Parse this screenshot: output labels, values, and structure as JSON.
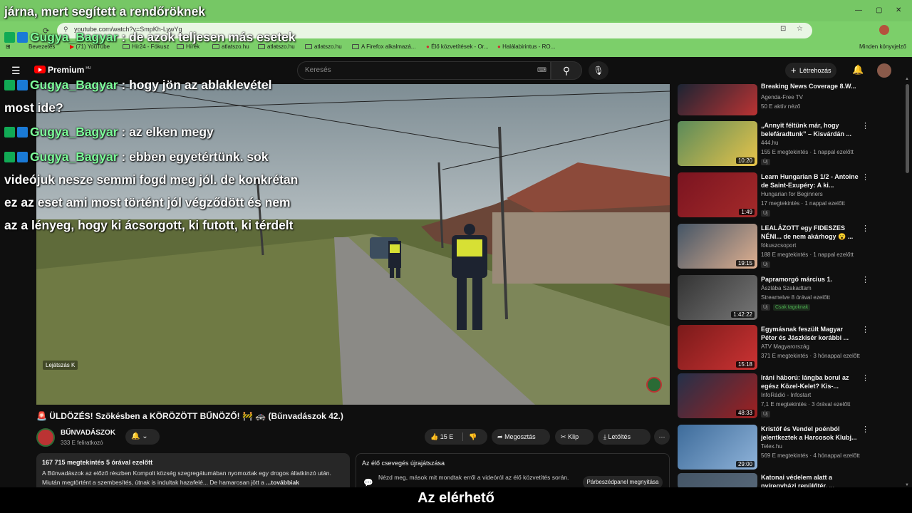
{
  "browser": {
    "url": "youtube.com/watch?v=SmpKh-LywYg",
    "bookmarks": [
      "Bevezetés",
      "(71) YouTube",
      "Hír24 - Fókusz",
      "Hírek",
      "atlatszo.hu",
      "atlatszo.hu",
      "atlatszo.hu",
      "A Firefox alkalmazá...",
      "Élő közvetítések - Or...",
      "Halálabirintus - RO..."
    ],
    "other_bookmarks": "Minden könyvjelző"
  },
  "yt": {
    "logo": "Premium",
    "region": "HU",
    "search_placeholder": "Keresés",
    "create": "Létrehozás"
  },
  "video": {
    "player_label": "Lejátszás",
    "player_key": "K",
    "title": "🚨 ÜLDÖZÉS! Szökésben a KÖRÖZÖTT BŰNÖZŐ! 🚧 🚓 (Bűnvadászok 42.)",
    "channel": "BŰNVADÁSZOK",
    "subscribers": "333 E feliratkozó",
    "likes": "15 E",
    "share": "Megosztás",
    "clip": "Klip",
    "download": "Letöltés",
    "desc_meta": "167 715 megtekintés  5 órával ezelőtt",
    "desc_text": "A Bűnvadászok az előző részben Kompolt község szegregátumában nyomoztak egy drogos állatkínzó után. Miután megtörtént a szembesítés, útnak is indultak hazafelé... De hamarosan jött a",
    "desc_more": " ...továbbiak",
    "chat_header": "Az élő csevegés újrajátszása",
    "chat_text": "Nézd meg, mások mit mondtak erről a videóról az élő közvetítés során.",
    "chat_button": "Párbeszédpanel megnyitása"
  },
  "sidebar": [
    {
      "title": "Breaking News Coverage 8.W...",
      "channel": "Agenda-Free TV",
      "meta": "50 E aktív néző",
      "duration": "",
      "badge": "",
      "member": ""
    },
    {
      "title": "„Annyit féltünk már, hogy belefáradtunk” – Kisvárdán ...",
      "channel": "444.hu",
      "meta": "155 E megtekintés · 1 nappal ezelőtt",
      "duration": "10:20",
      "badge": "Új",
      "member": ""
    },
    {
      "title": "Learn Hungarian B 1/2 - Antoine de Saint-Exupéry: A ki...",
      "channel": "Hungarian for Beginners",
      "meta": "17 megtekintés · 1 nappal ezelőtt",
      "duration": "1:49",
      "badge": "Új",
      "member": ""
    },
    {
      "title": "LEALÁZOTT egy FIDESZES NÉNI... de nem akárhogy 😮 ...",
      "channel": "fókuszcsoport",
      "meta": "188 E megtekintés · 1 nappal ezelőtt",
      "duration": "19:15",
      "badge": "Új",
      "member": ""
    },
    {
      "title": "Papramorgó március 1.",
      "channel": "Ászlába Szakadtam",
      "meta": "Streamelve 8 órával ezelőtt",
      "duration": "1:42:22",
      "badge": "Új",
      "member": "Csak tagoknak"
    },
    {
      "title": "Egymásnak feszült Magyar Péter és Jászkisér korábbi ...",
      "channel": "ATV Magyarország",
      "meta": "371 E megtekintés · 3 hónappal ezelőtt",
      "duration": "15:18",
      "badge": "",
      "member": ""
    },
    {
      "title": "Iráni háború: lángba borul az egész Közel-Kelet? Kis-...",
      "channel": "InfoRádió - Infostart",
      "meta": "7,1 E megtekintés · 3 órával ezelőtt",
      "duration": "48:33",
      "badge": "Új",
      "member": ""
    },
    {
      "title": "Kristóf és Vendel poénból jelentkeztek a Harcosok Klubj...",
      "channel": "Telex.hu",
      "meta": "569 E megtekintés · 4 hónappal ezelőtt",
      "duration": "29:00",
      "badge": "",
      "member": ""
    },
    {
      "title": "Katonai védelem alatt a nyíregyházi repülőtér, ...",
      "channel": "",
      "meta": "",
      "duration": "",
      "badge": "",
      "member": ""
    }
  ],
  "overlay_chat": [
    {
      "user": "",
      "text": "járna, mert segített a rendőröknek"
    },
    {
      "user": "Gugya_Bagyar",
      "text": "de azok teljesen más esetek"
    },
    {
      "user": "Gugya_Bagyar",
      "text": "hogy jön az ablaklevétel most ide?"
    },
    {
      "user": "Gugya_Bagyar",
      "text": "az elken megy"
    },
    {
      "user": "Gugya_Bagyar",
      "text": "ebben egyetértünk. sok videójuk nesze semmi fogd meg jól. de konkrétan ez az eset ami most történt jól végződött és nem az a lényeg, hogy ki ácsorgott, ki futott, ki térdelt"
    }
  ],
  "caption": "Az elérhető"
}
